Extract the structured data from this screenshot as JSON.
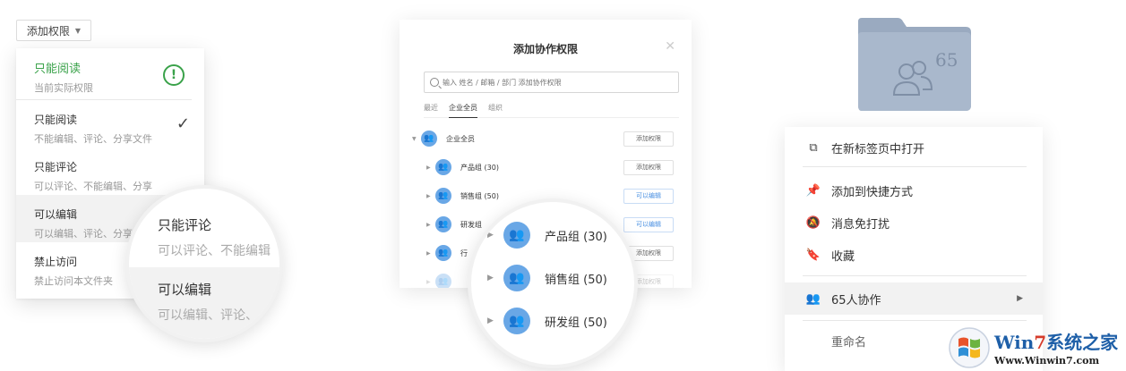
{
  "permission_panel": {
    "trigger_label": "添加权限",
    "current": {
      "title": "只能阅读",
      "subtitle": "当前实际权限"
    },
    "options": [
      {
        "title": "只能阅读",
        "subtitle": "不能编辑、评论、分享文件",
        "checked": true
      },
      {
        "title": "只能评论",
        "subtitle": "可以评论、不能编辑、分享"
      },
      {
        "title": "可以编辑",
        "subtitle": "可以编辑、评论、分享"
      },
      {
        "title": "禁止访问",
        "subtitle": "禁止访问本文件夹"
      }
    ],
    "magnified": [
      {
        "title": "只能评论",
        "subtitle": "可以评论、不能编辑"
      },
      {
        "title": "可以编辑",
        "subtitle": "可以编辑、评论、"
      }
    ]
  },
  "collab_dialog": {
    "title": "添加协作权限",
    "search_placeholder": "输入 姓名 / 邮箱 / 部门 添加协作权限",
    "tabs": [
      "最近",
      "企业全员",
      "组织"
    ],
    "active_tab": "企业全员",
    "rows": [
      {
        "name": "企业全员",
        "perm": "添加权限",
        "expanded": true
      },
      {
        "name": "产品组 (30)",
        "perm": "添加权限"
      },
      {
        "name": "销售组 (50)",
        "perm": "可以编辑"
      },
      {
        "name": "研发组",
        "perm": "可以编辑"
      },
      {
        "name": "行",
        "perm": "添加权限"
      },
      {
        "name": "",
        "perm": "添加权限"
      }
    ],
    "magnified": [
      {
        "name": "产品组 (30)"
      },
      {
        "name": "销售组 (50)"
      },
      {
        "name": "研发组 (50)"
      }
    ],
    "accent": "#69a7e6"
  },
  "folder_panel": {
    "folder_badge": "65",
    "folder_color": "#9eaec4",
    "menu": [
      {
        "label": "在新标签页中打开",
        "icon": "open-in-new-tab-icon"
      },
      {
        "label": "添加到快捷方式",
        "icon": "pin-icon"
      },
      {
        "label": "消息免打扰",
        "icon": "mute-bell-icon"
      },
      {
        "label": "收藏",
        "icon": "bookmark-icon"
      },
      {
        "label": "65人协作",
        "icon": "users-icon",
        "submenu": true
      },
      {
        "label": "重命名",
        "icon": ""
      }
    ]
  },
  "watermark": {
    "brand_a": "Win",
    "brand_7": "7",
    "brand_cn": "系统之家",
    "url": "Www.Winwin7.com"
  }
}
